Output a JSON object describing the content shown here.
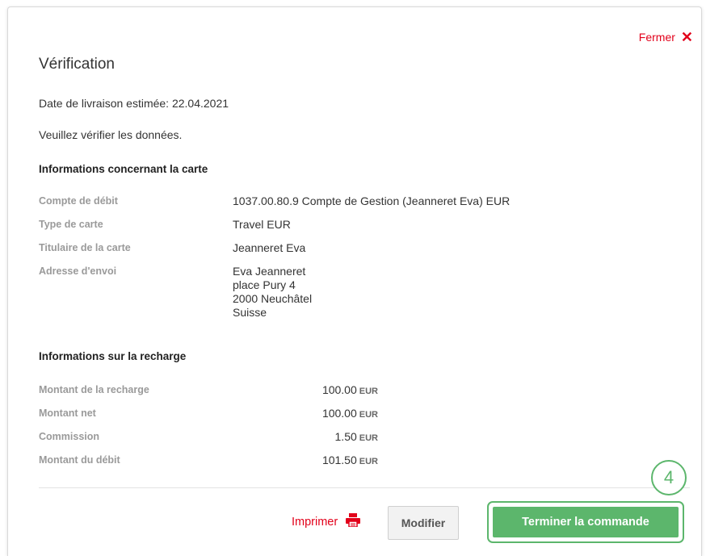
{
  "dialog": {
    "close_label": "Fermer",
    "title": "Vérification",
    "delivery_text": "Date de livraison estimée: 22.04.2021",
    "verify_text": "Veuillez vérifier les données."
  },
  "card_section": {
    "heading": "Informations concernant la carte",
    "rows": [
      {
        "label": "Compte de débit",
        "value": "1037.00.80.9 Compte de Gestion (Jeanneret Eva) EUR"
      },
      {
        "label": "Type de carte",
        "value": "Travel EUR"
      },
      {
        "label": "Titulaire de la carte",
        "value": "Jeanneret Eva"
      },
      {
        "label": "Adresse d'envoi",
        "address_lines": [
          "Eva Jeanneret",
          "place Pury 4",
          "2000 Neuchâtel",
          "Suisse"
        ]
      }
    ]
  },
  "recharge_section": {
    "heading": "Informations sur la recharge",
    "rows": [
      {
        "label": "Montant de la recharge",
        "amount": "100.00",
        "currency": "EUR"
      },
      {
        "label": "Montant net",
        "amount": "100.00",
        "currency": "EUR"
      },
      {
        "label": "Commission",
        "amount": "1.50",
        "currency": "EUR"
      },
      {
        "label": "Montant du débit",
        "amount": "101.50",
        "currency": "EUR"
      }
    ]
  },
  "footer": {
    "print_label": "Imprimer",
    "modify_label": "Modifier",
    "finish_label": "Terminer la commande",
    "step_number": "4"
  },
  "colors": {
    "accent_red": "#e2001a",
    "accent_green": "#5cb66c"
  },
  "icons": {
    "close": "close-icon",
    "print": "printer-icon"
  }
}
